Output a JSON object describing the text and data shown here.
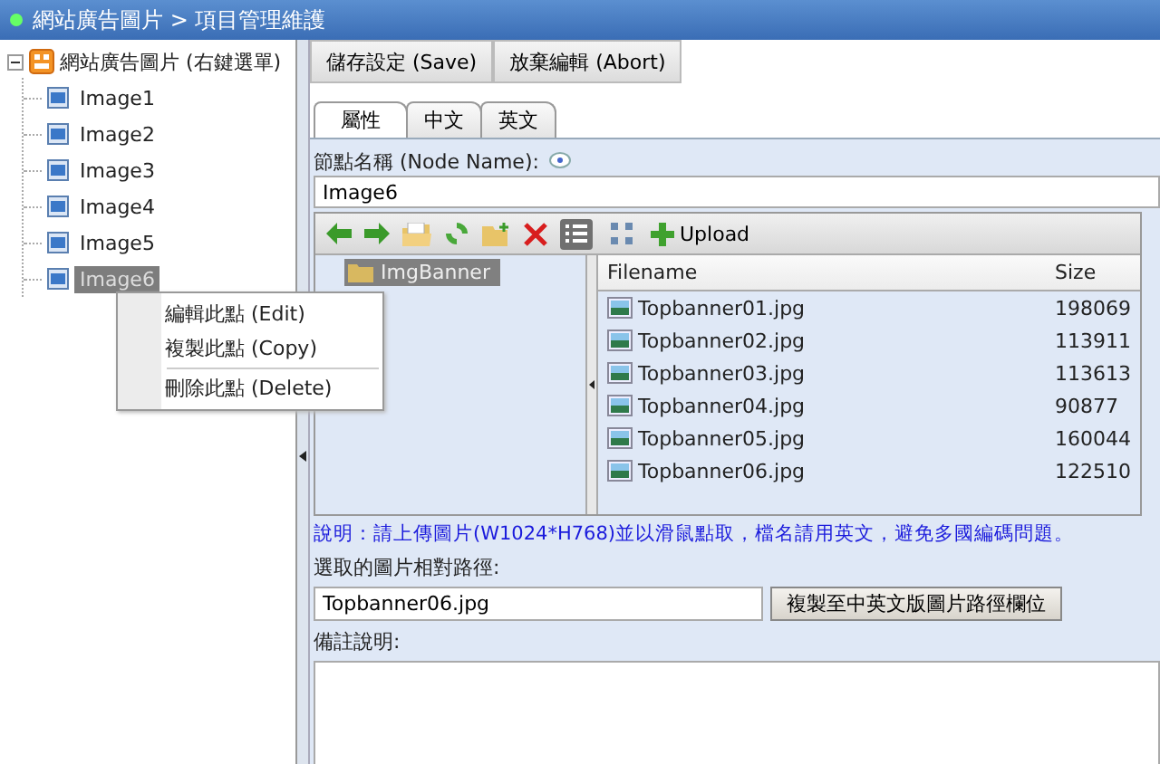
{
  "window": {
    "title": "網站廣告圖片 > 項目管理維護"
  },
  "tree": {
    "label": "網站廣告圖片 (右鍵選單)",
    "expanded": true,
    "children": [
      {
        "label": "Image1",
        "selected": false
      },
      {
        "label": "Image2",
        "selected": false
      },
      {
        "label": "Image3",
        "selected": false
      },
      {
        "label": "Image4",
        "selected": false
      },
      {
        "label": "Image5",
        "selected": false
      },
      {
        "label": "Image6",
        "selected": true
      }
    ]
  },
  "context_menu": {
    "items": [
      {
        "kind": "item",
        "label": "編輯此點 (Edit)"
      },
      {
        "kind": "item",
        "label": "複製此點 (Copy)"
      },
      {
        "kind": "separator"
      },
      {
        "kind": "item",
        "label": "刪除此點 (Delete)"
      }
    ]
  },
  "toolbar": {
    "buttons": [
      "儲存設定 (Save)",
      "放棄編輯 (Abort)"
    ]
  },
  "tabs": [
    {
      "label": "屬性",
      "selected": true
    },
    {
      "label": "中文",
      "selected": false
    },
    {
      "label": "英文",
      "selected": false
    }
  ],
  "node_name": {
    "label": "節點名稱 (Node Name):",
    "value": "Image6"
  },
  "file_browser": {
    "view_buttons": [
      {
        "kind": "details",
        "selected": true
      },
      {
        "kind": "thumbnails",
        "selected": false
      }
    ],
    "upload": "Upload",
    "folders": [
      {
        "label": "ImgBanner",
        "selected": true
      }
    ],
    "columns": [
      "Filename",
      "Size"
    ],
    "files": [
      {
        "name": "Topbanner01.jpg",
        "size": "198069"
      },
      {
        "name": "Topbanner02.jpg",
        "size": "113911"
      },
      {
        "name": "Topbanner03.jpg",
        "size": "113613"
      },
      {
        "name": "Topbanner04.jpg",
        "size": "90877"
      },
      {
        "name": "Topbanner05.jpg",
        "size": "160044"
      },
      {
        "name": "Topbanner06.jpg",
        "size": "122510"
      }
    ]
  },
  "notice": "說明：請上傳圖片(W1024*H768)並以滑鼠點取，檔名請用英文，避免多國編碼問題。",
  "path": {
    "label": "選取的圖片相對路徑:",
    "value": "Topbanner06.jpg",
    "button": "複製至中英文版圖片路徑欄位"
  },
  "remarks": {
    "label": "備註說明:"
  }
}
